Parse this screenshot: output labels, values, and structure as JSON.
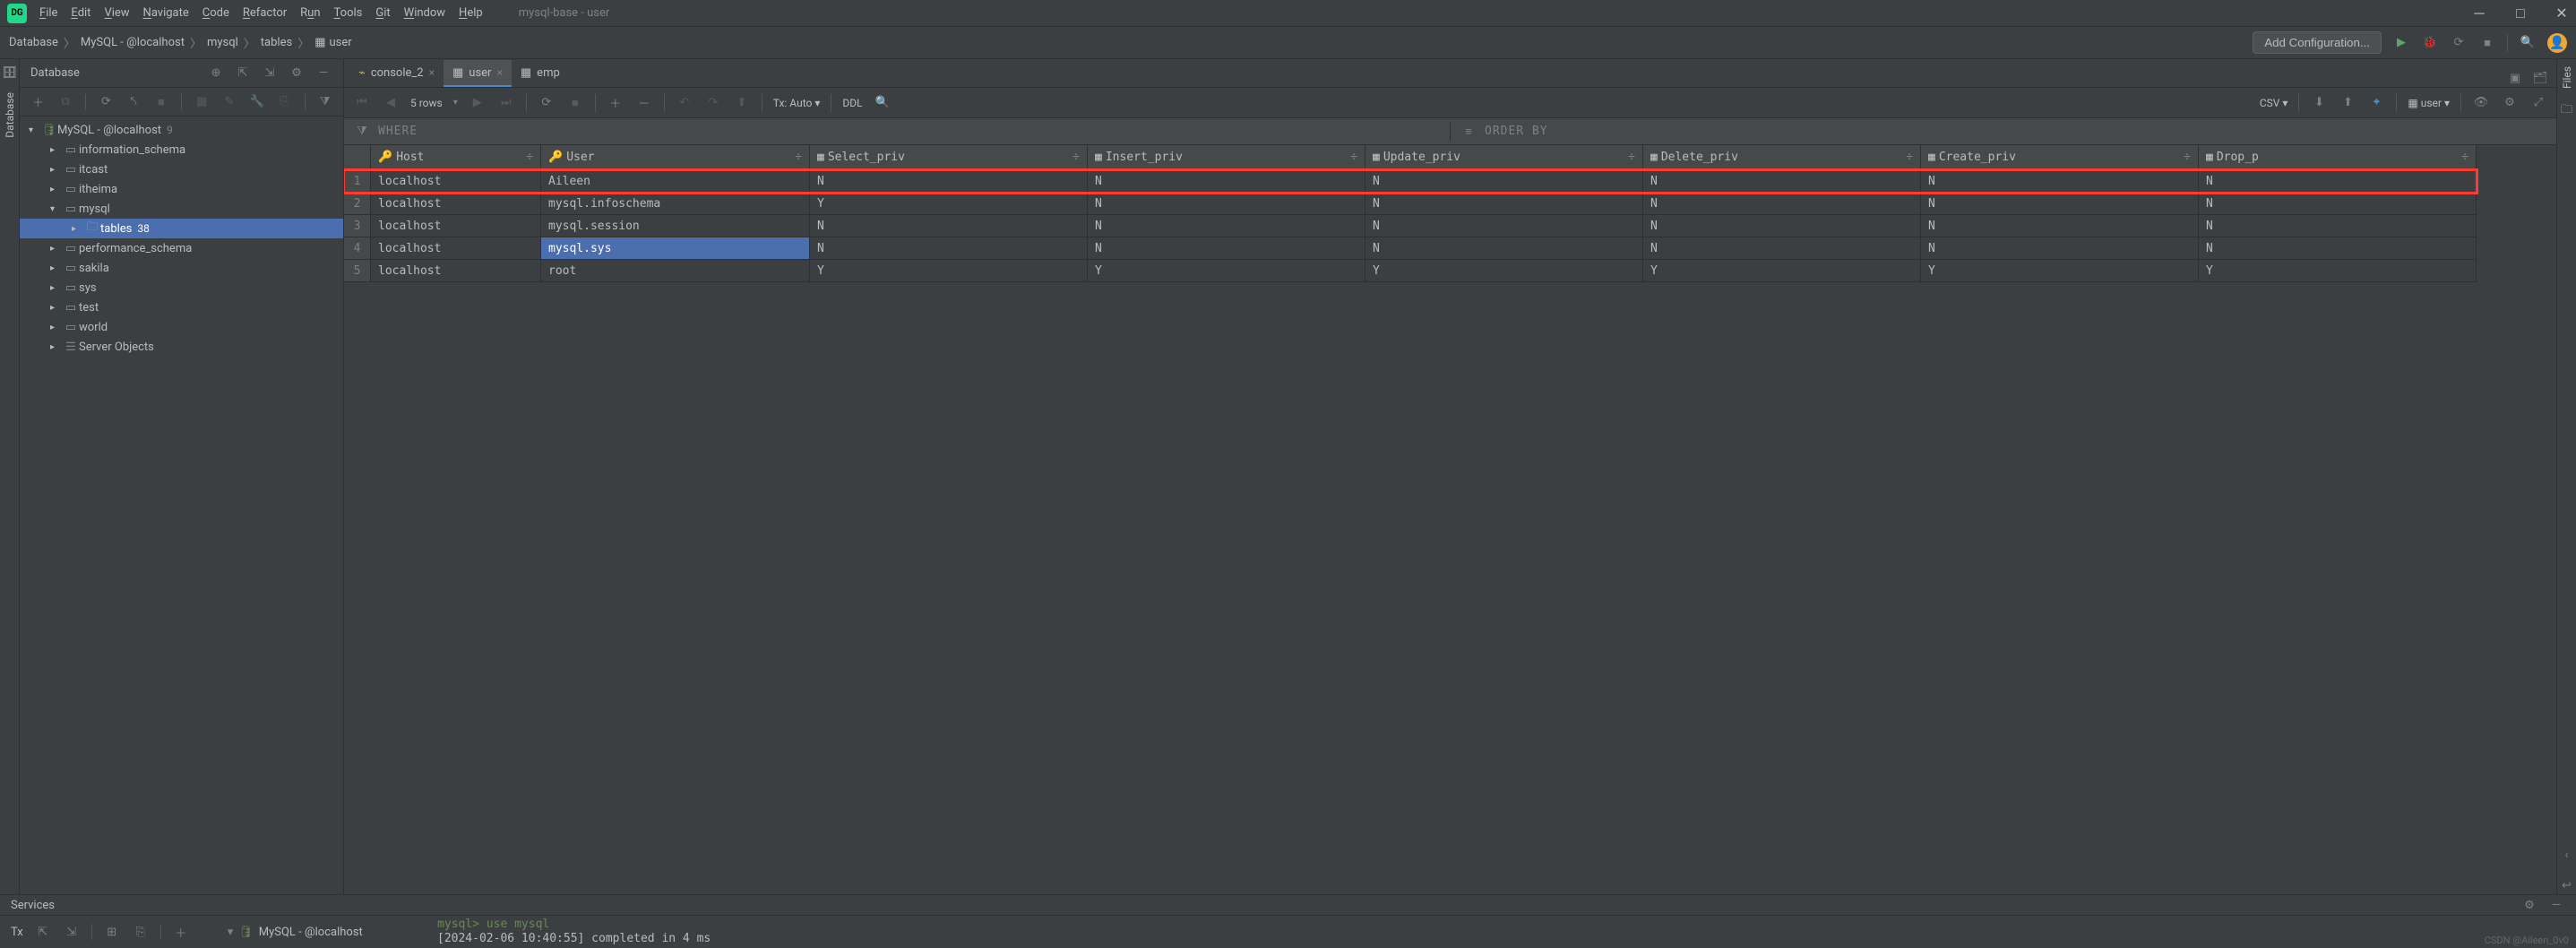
{
  "window": {
    "title": "mysql-base - user"
  },
  "menu": [
    "File",
    "Edit",
    "View",
    "Navigate",
    "Code",
    "Refactor",
    "Run",
    "Tools",
    "Git",
    "Window",
    "Help"
  ],
  "breadcrumb": [
    "Database",
    "MySQL - @localhost",
    "mysql",
    "tables",
    "user"
  ],
  "add_config": "Add Configuration...",
  "db_panel": {
    "title": "Database",
    "root": {
      "label": "MySQL - @localhost",
      "count": "9"
    },
    "schemas": [
      {
        "label": "information_schema"
      },
      {
        "label": "itcast"
      },
      {
        "label": "itheima"
      },
      {
        "label": "mysql",
        "expanded": true,
        "children": [
          {
            "label": "tables",
            "count": "38",
            "selected": true
          }
        ]
      },
      {
        "label": "performance_schema"
      },
      {
        "label": "sakila"
      },
      {
        "label": "sys"
      },
      {
        "label": "test"
      },
      {
        "label": "world"
      },
      {
        "label": "Server Objects",
        "icon": "server"
      }
    ]
  },
  "tabs": [
    {
      "label": "console_2",
      "icon": "console",
      "closable": true
    },
    {
      "label": "user",
      "icon": "table",
      "active": true,
      "closable": true
    },
    {
      "label": "emp",
      "icon": "table"
    }
  ],
  "ed_toolbar": {
    "rows": "5 rows",
    "tx": "Tx: Auto",
    "ddl": "DDL",
    "csv": "CSV",
    "user": "user"
  },
  "filter": {
    "where": "WHERE",
    "orderby": "ORDER BY"
  },
  "table": {
    "columns": [
      "Host",
      "User",
      "Select_priv",
      "Insert_priv",
      "Update_priv",
      "Delete_priv",
      "Create_priv",
      "Drop_p"
    ],
    "rows": [
      {
        "n": 1,
        "host": "localhost",
        "user": "Aileen",
        "vals": [
          "N",
          "N",
          "N",
          "N",
          "N",
          "N"
        ],
        "hl": true
      },
      {
        "n": 2,
        "host": "localhost",
        "user": "mysql.infoschema",
        "vals": [
          "Y",
          "N",
          "N",
          "N",
          "N",
          "N"
        ]
      },
      {
        "n": 3,
        "host": "localhost",
        "user": "mysql.session",
        "vals": [
          "N",
          "N",
          "N",
          "N",
          "N",
          "N"
        ]
      },
      {
        "n": 4,
        "host": "localhost",
        "user": "mysql.sys",
        "vals": [
          "N",
          "N",
          "N",
          "N",
          "N",
          "N"
        ],
        "sel": "user"
      },
      {
        "n": 5,
        "host": "localhost",
        "user": "root",
        "vals": [
          "Y",
          "Y",
          "Y",
          "Y",
          "Y",
          "Y"
        ]
      }
    ]
  },
  "services": {
    "title": "Services",
    "ds_label": "MySQL - @localhost",
    "console": {
      "prompt": "mysql> use mysql",
      "line2": "[2024-02-06 10:40:55] completed in 4 ms"
    }
  },
  "watermark": "CSDN @Aileen_0v0"
}
